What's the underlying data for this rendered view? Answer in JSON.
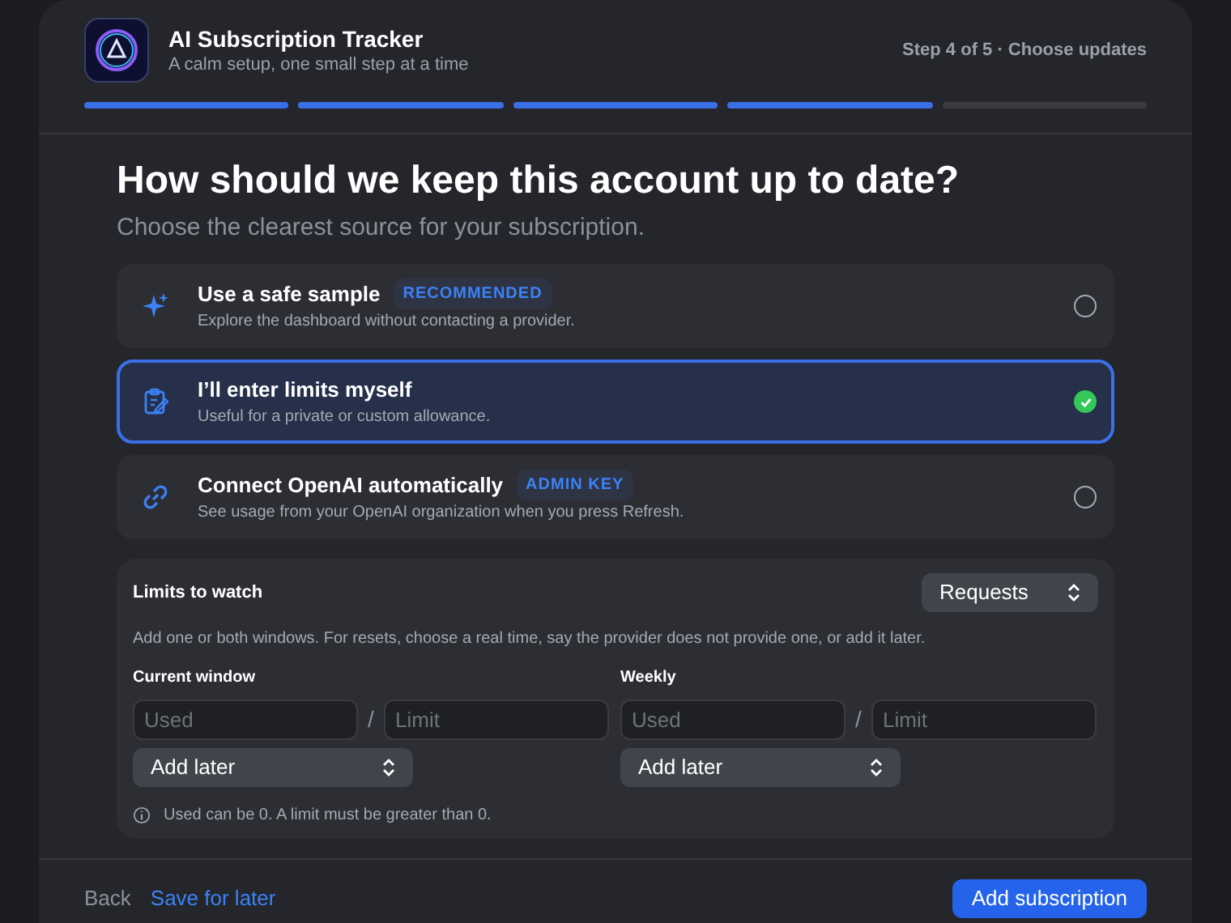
{
  "app": {
    "title": "AI Subscription Tracker",
    "subtitle": "A calm setup, one small step at a time",
    "step": "Step 4 of 5 · Choose updates"
  },
  "progress": [
    {
      "done": true
    },
    {
      "done": true
    },
    {
      "done": true
    },
    {
      "done": true
    },
    {
      "done": false
    }
  ],
  "heading": "How should we keep this account up to date?",
  "subheading": "Choose the clearest source for your subscription.",
  "options": [
    {
      "kind": "sample",
      "title": "Use a safe sample",
      "badge": "RECOMMENDED",
      "description": "Explore the dashboard without contacting a provider.",
      "selected": false
    },
    {
      "kind": "manual",
      "title": "I’ll enter limits myself",
      "description": "Useful for a private or custom allowance.",
      "selected": true
    },
    {
      "kind": "link",
      "title": "Connect OpenAI automatically",
      "badge": "ADMIN KEY",
      "description": "See usage from your OpenAI organization when you press Refresh.",
      "selected": false
    }
  ],
  "limits": {
    "title": "Limits to watch",
    "unit": "Requests",
    "help": "Add one or both windows. For resets, choose a real time, say the provider does not provide one, or add it later.",
    "windows": [
      {
        "label": "Current window",
        "used_placeholder": "Used",
        "separator": "/",
        "limit_placeholder": "Limit",
        "reset": "Add later"
      },
      {
        "label": "Weekly",
        "used_placeholder": "Used",
        "separator": "/",
        "limit_placeholder": "Limit",
        "reset": "Add later"
      }
    ],
    "note": "Used can be 0. A limit must be greater than 0."
  },
  "footer": {
    "back": "Back",
    "save": "Save for later",
    "submit": "Add subscription"
  }
}
